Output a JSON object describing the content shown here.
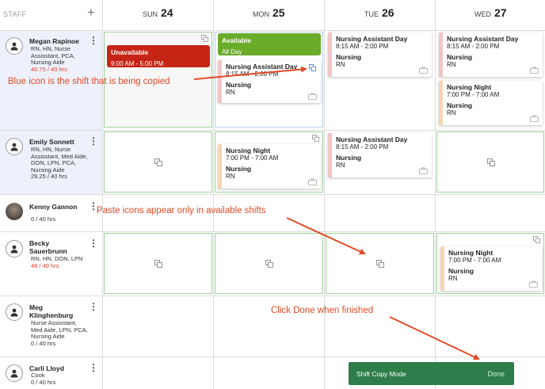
{
  "header": {
    "staff_label": "STAFF",
    "add_symbol": "+"
  },
  "days": [
    {
      "dow": "SUN",
      "num": "24"
    },
    {
      "dow": "MON",
      "num": "25"
    },
    {
      "dow": "TUE",
      "num": "26"
    },
    {
      "dow": "WED",
      "num": "27"
    }
  ],
  "staff": [
    {
      "name": "Megan Rapinoe",
      "roles": "RN, HN, Nurse Assisstant, PCA, Nursing Aide",
      "hours": "40.75 / 40 hrs",
      "over": true
    },
    {
      "name": "Emily Sonnett",
      "roles": "RN, HN, Nurse Assisstant, Med Aide, DON, LPN, PCA, Nursing Aide",
      "hours": "29.25 / 40 hrs",
      "over": false
    },
    {
      "name": "Kenny Gannon",
      "roles": "",
      "hours": "0 / 40 hrs",
      "over": false
    },
    {
      "name": "Becky Sauerbrunn",
      "roles": "RN, HN, DON, LPN",
      "hours": "48 / 40 hrs",
      "over": true
    },
    {
      "name": "Meg Klinghenburg",
      "roles": "Nurse Assisstant, Med Aide, LPN, PCA, Nursing Aide",
      "hours": "0 / 40 hrs",
      "over": false
    },
    {
      "name": "Carli Lloyd",
      "roles": "Cook",
      "hours": "0 / 40 hrs",
      "over": false
    }
  ],
  "availability": {
    "unavailable": {
      "label": "Unavailable",
      "time": "9:00 AM - 5:00 PM"
    },
    "available": {
      "label": "Available",
      "time": "All Day"
    }
  },
  "shifts": {
    "megan_mon": {
      "title": "Nursing Assistant Day",
      "time": "8:15 AM - 2:00 PM",
      "position": "Nursing",
      "role": "RN"
    },
    "megan_tue": {
      "title": "Nursing Assistant Day",
      "time": "8:15 AM - 2:00 PM",
      "position": "Nursing",
      "role": "RN"
    },
    "megan_wed_day": {
      "title": "Nursing Assistant Day",
      "time": "8:15 AM - 2:00 PM",
      "position": "Nursing",
      "role": "RN"
    },
    "megan_wed_night": {
      "title": "Nursing Night",
      "time": "7:00 PM - 7:00 AM",
      "position": "Nursing",
      "role": "RN"
    },
    "emily_mon": {
      "title": "Nursing Night",
      "time": "7:00 PM - 7:00 AM",
      "position": "Nursing",
      "role": "RN"
    },
    "emily_tue": {
      "title": "Nursing Assistant Day",
      "time": "8:15 AM - 2:00 PM",
      "position": "Nursing",
      "role": "RN"
    },
    "becky_wed": {
      "title": "Nursing Night",
      "time": "7:00 PM - 7:00 AM",
      "position": "Nursing",
      "role": "RN"
    }
  },
  "annotations": {
    "blue_icon": "Blue icon is the shift that is being copied",
    "paste_icons": "Paste icons appear only in available shifts",
    "click_done": "Click Done when finished"
  },
  "copy_mode": {
    "label": "Shift Copy Mode",
    "done": "Done"
  },
  "colors": {
    "accent_blue": "#3a7bd5",
    "annotation": "#e24a26",
    "copy_bar": "#2e7d4a",
    "unavailable": "#c62516",
    "available": "#6aab2a"
  }
}
